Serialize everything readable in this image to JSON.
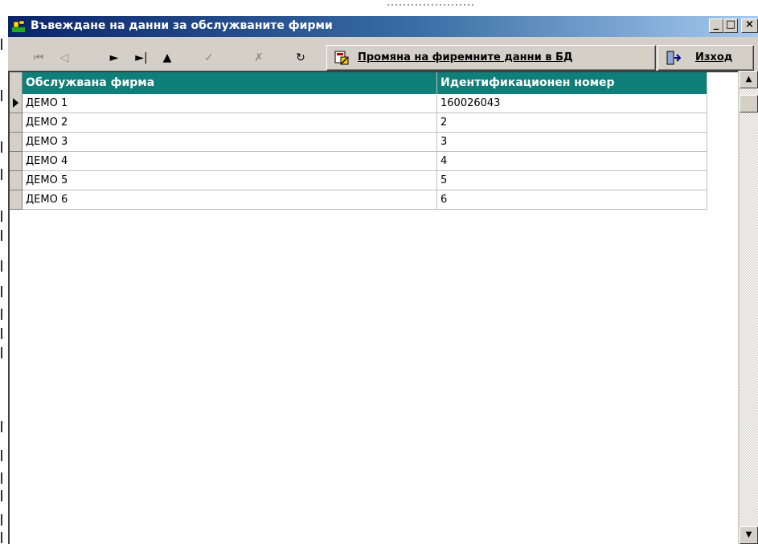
{
  "window": {
    "title": "Въвеждане на данни за обслужваните фирми",
    "controls": {
      "minimize": "_",
      "maximize": "□",
      "close": "×"
    },
    "accent": "#0a246a"
  },
  "navigator": {
    "buttons": [
      {
        "name": "first-icon",
        "glyph": "⏮",
        "enabled": false
      },
      {
        "name": "prior-icon",
        "glyph": "◁",
        "enabled": false
      },
      {
        "name": "next-icon",
        "glyph": "►",
        "enabled": true
      },
      {
        "name": "last-icon",
        "glyph": "►|",
        "enabled": true
      },
      {
        "name": "insert-icon",
        "glyph": "▲",
        "enabled": true
      },
      {
        "name": "post-icon",
        "glyph": "✓",
        "enabled": false
      },
      {
        "name": "cancel-icon",
        "glyph": "✗",
        "enabled": false
      },
      {
        "name": "refresh-icon",
        "glyph": "↻",
        "enabled": true
      }
    ]
  },
  "toolbar": {
    "change_label": "Промяна на фиремните данни в БД",
    "exit_label": "Изход"
  },
  "grid": {
    "header_color": "#0f7f7a",
    "columns": [
      "Обслужвана фирма",
      "Идентификационен номер"
    ],
    "rows": [
      {
        "firm": "ДЕМО 1",
        "id": "160026043",
        "current": true
      },
      {
        "firm": "ДЕМО 2",
        "id": "2"
      },
      {
        "firm": "ДЕМО 3",
        "id": "3"
      },
      {
        "firm": "ДЕМО 4",
        "id": "4"
      },
      {
        "firm": "ДЕМО 5",
        "id": "5"
      },
      {
        "firm": "ДЕМО 6",
        "id": "6"
      }
    ]
  },
  "scrollbar": {
    "up": "▲",
    "down": "▼"
  }
}
